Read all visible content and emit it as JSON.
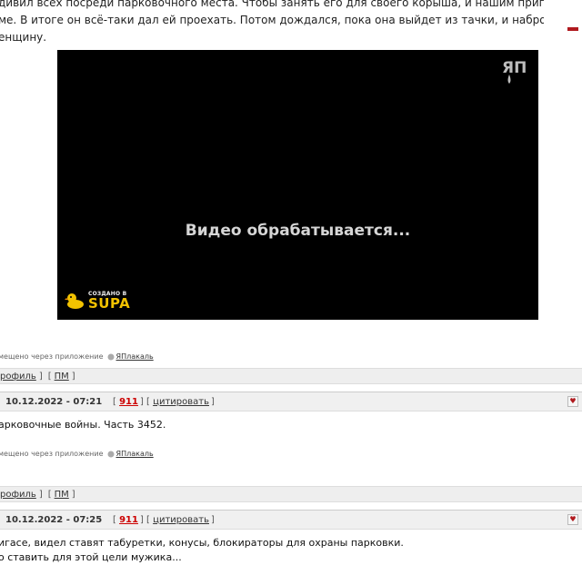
{
  "post0": {
    "lines": [
      "дивил всех посреди парковочного места. Чтобы занять его для своего корыша, и нашим припарковаться",
      "ме. В итоге он всё-таки дал ей проехать. Потом дождался, пока она выйдет из тачки, и набросился на",
      "енщину."
    ],
    "video": {
      "status_text": "Видео обрабатывается...",
      "watermark": "ЯП",
      "badge_small": "СОЗДАНО В",
      "badge_big": "SUPA"
    },
    "app_note": "мещено через приложение",
    "app_link": "ЯПлакаль"
  },
  "post1_bar": {
    "profile": "рофиль",
    "pm": "ПМ"
  },
  "post1": {
    "date": "10.12.2022 - 07:21",
    "number": "911",
    "quote": "цитировать",
    "text": "арковочные войны. Часть 3452.",
    "app_note": "мещено через приложение",
    "app_link": "ЯПлакаль"
  },
  "post2_bar": {
    "profile": "рофиль",
    "pm": "ПМ"
  },
  "post2": {
    "date": "10.12.2022 - 07:25",
    "number": "911",
    "quote": "цитировать",
    "lines": [
      "игасе, видел ставят табуретки, конусы, блокираторы для охраны парковки.",
      "о ставить для этой цели мужика..."
    ]
  },
  "colors": {
    "accent": "#c00000",
    "bar_bg": "#eeeeee",
    "video_bg": "#000000",
    "badge": "#f2c200"
  },
  "icons": [
    "yaplakal-app-icon",
    "favorite-icon",
    "duck-icon",
    "yap-watermark-icon"
  ]
}
